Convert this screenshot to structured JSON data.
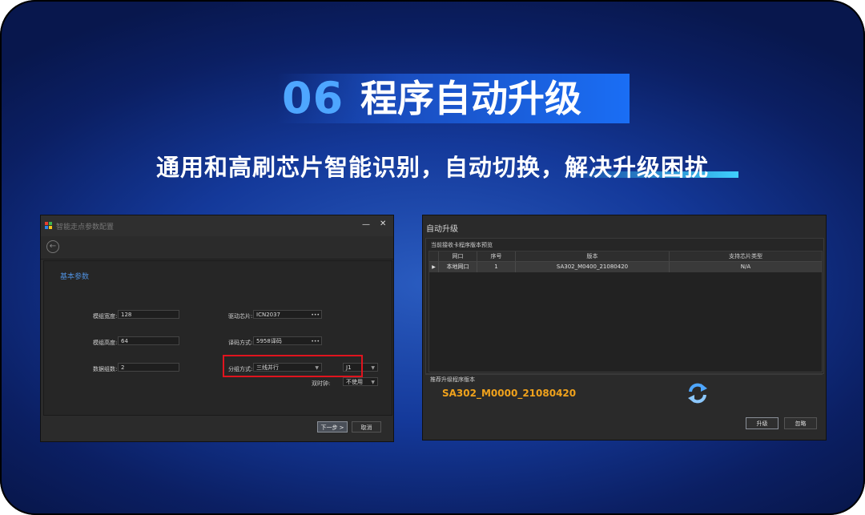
{
  "header": {
    "number": "06",
    "title": "程序自动升级",
    "subtitle": "通用和高刷芯片智能识别，自动切换，解决升级困扰"
  },
  "left_window": {
    "title": "智能走点参数配置",
    "minimize": "—",
    "close": "✕",
    "back_icon": "back-arrow-icon",
    "section_title": "基本参数",
    "fields": {
      "module_width_label": "模组宽度:",
      "module_width_value": "128",
      "module_height_label": "模组高度:",
      "module_height_value": "64",
      "data_groups_label": "数据组数:",
      "data_groups_value": "2",
      "driver_chip_label": "驱动芯片:",
      "driver_chip_value": "ICN2037",
      "decode_mode_label": "译码方式:",
      "decode_mode_value": "5958译码",
      "group_mode_label": "分组方式:",
      "group_mode_value": "三线并行",
      "group_extra_value": "J1",
      "clock_label": "双时钟:",
      "clock_value": "不使用"
    },
    "buttons": {
      "next": "下一步 >",
      "cancel": "取消"
    }
  },
  "right_window": {
    "title": "自动升级",
    "group_label": "当前接收卡程序版本预览",
    "columns": [
      "网口",
      "序号",
      "版本",
      "支持芯片类型"
    ],
    "rows": [
      {
        "port": "本地网口",
        "index": "1",
        "version": "SA302_M0400_21080420",
        "chip": "N/A"
      }
    ],
    "recommend_label": "推荐升级程序版本",
    "recommend_version": "SA302_M0000_21080420",
    "refresh_icon": "refresh-icon",
    "buttons": {
      "upgrade": "升级",
      "ignore": "忽略"
    }
  },
  "colors": {
    "accent_blue": "#4ea6ff",
    "version_orange": "#f0a21c",
    "highlight_red": "#e0141e"
  }
}
